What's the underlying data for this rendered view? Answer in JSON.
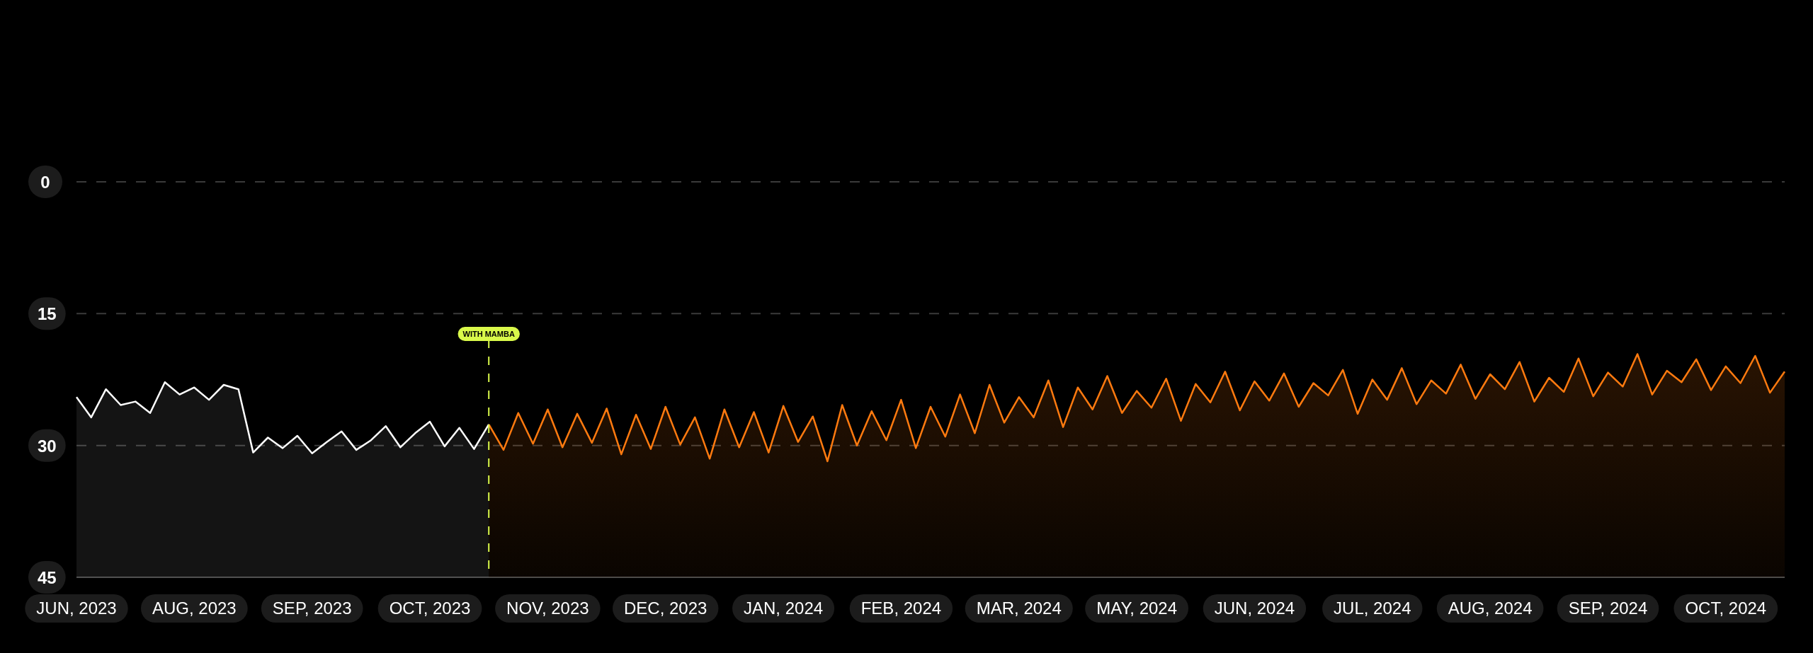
{
  "chart_data": {
    "type": "line",
    "categories": [
      "JUN, 2023",
      null,
      null,
      null,
      null,
      null,
      null,
      null,
      "AUG, 2023",
      null,
      null,
      null,
      null,
      null,
      null,
      null,
      "SEP, 2023",
      null,
      null,
      null,
      null,
      null,
      null,
      null,
      "OCT, 2023",
      null,
      null,
      null,
      null,
      null,
      null,
      null,
      "NOV, 2023",
      null,
      null,
      null,
      null,
      null,
      null,
      null,
      "DEC, 2023",
      null,
      null,
      null,
      null,
      null,
      null,
      null,
      "JAN, 2024",
      null,
      null,
      null,
      null,
      null,
      null,
      null,
      "FEB, 2024",
      null,
      null,
      null,
      null,
      null,
      null,
      null,
      "MAR, 2024",
      null,
      null,
      null,
      null,
      null,
      null,
      null,
      "MAY, 2024",
      null,
      null,
      null,
      null,
      null,
      null,
      null,
      "JUN, 2024",
      null,
      null,
      null,
      null,
      null,
      null,
      null,
      "JUL, 2024",
      null,
      null,
      null,
      null,
      null,
      null,
      null,
      "AUG, 2024",
      null,
      null,
      null,
      null,
      null,
      null,
      null,
      "SEP, 2024",
      null,
      null,
      null,
      null,
      null,
      null,
      null,
      "OCT, 2024",
      null,
      null,
      null,
      null
    ],
    "series": [
      {
        "color": "#ffffff",
        "values": [
          24.5,
          26.8,
          23.6,
          25.4,
          25.0,
          26.3,
          22.8,
          24.2,
          23.4,
          24.8,
          23.1,
          23.6,
          30.8,
          29.1,
          30.3,
          28.9,
          30.9,
          29.6,
          28.4,
          30.5,
          29.4,
          27.8,
          30.2,
          28.6,
          27.3,
          30.1,
          28.0,
          30.4,
          27.6,
          null,
          null,
          null,
          null,
          null,
          null,
          null,
          null,
          null,
          null,
          null,
          null,
          null,
          null,
          null,
          null,
          null,
          null,
          null,
          null,
          null,
          null,
          null,
          null,
          null,
          null,
          null,
          null,
          null,
          null,
          null,
          null,
          null,
          null,
          null,
          null,
          null,
          null,
          null,
          null,
          null,
          null,
          null,
          null,
          null,
          null,
          null,
          null,
          null,
          null,
          null,
          null,
          null,
          null,
          null,
          null,
          null,
          null,
          null,
          null,
          null,
          null,
          null,
          null,
          null,
          null,
          null,
          null,
          null,
          null,
          null,
          null,
          null,
          null,
          null,
          null,
          null,
          null,
          null,
          null,
          null,
          null,
          null,
          null,
          null,
          null,
          null,
          null
        ]
      },
      {
        "color": "#ff7a0f",
        "values": [
          null,
          null,
          null,
          null,
          null,
          null,
          null,
          null,
          null,
          null,
          null,
          null,
          null,
          null,
          null,
          null,
          null,
          null,
          null,
          null,
          null,
          null,
          null,
          null,
          null,
          null,
          null,
          null,
          27.6,
          30.5,
          26.3,
          29.8,
          25.9,
          30.2,
          26.4,
          29.7,
          25.8,
          31.0,
          26.5,
          30.4,
          25.6,
          29.9,
          26.8,
          31.5,
          25.9,
          30.2,
          26.2,
          30.8,
          25.5,
          29.6,
          26.7,
          31.8,
          25.4,
          30.0,
          26.1,
          29.4,
          24.8,
          30.3,
          25.6,
          29.0,
          24.2,
          28.6,
          23.1,
          27.4,
          24.5,
          26.8,
          22.6,
          27.9,
          23.4,
          25.9,
          22.1,
          26.3,
          23.8,
          25.7,
          22.4,
          27.2,
          23.0,
          25.1,
          21.6,
          26.0,
          22.7,
          24.9,
          21.8,
          25.6,
          22.9,
          24.3,
          21.4,
          26.4,
          22.5,
          24.8,
          21.2,
          25.3,
          22.6,
          24.1,
          20.8,
          24.7,
          21.9,
          23.6,
          20.5,
          25.0,
          22.3,
          23.9,
          20.1,
          24.4,
          21.7,
          23.3,
          19.6,
          24.2,
          21.5,
          22.8,
          20.2,
          23.7,
          21.0,
          22.9,
          19.8,
          24.0,
          21.6
        ]
      }
    ],
    "ylim": [
      45,
      0
    ],
    "yticks": [
      0,
      15,
      30,
      45
    ],
    "annotations": [
      {
        "text": "WITH MAMBA"
      }
    ]
  }
}
